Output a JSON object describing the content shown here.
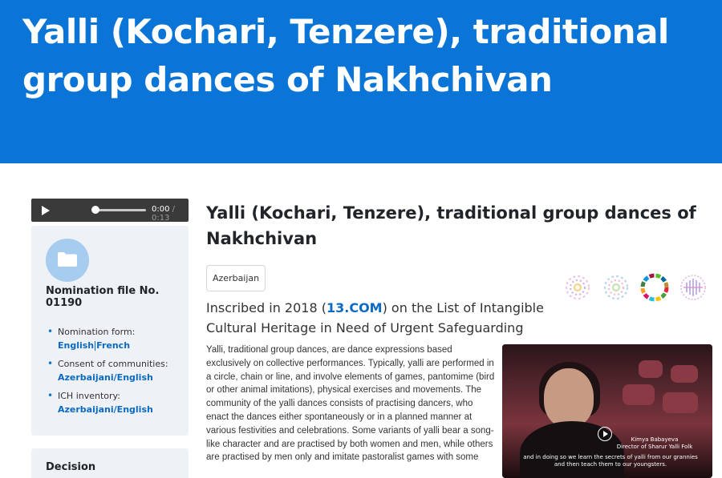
{
  "banner": {
    "title": "Yalli (Kochari, Tenzere), traditional group dances of Nakhchivan"
  },
  "player": {
    "current_time": "0:00",
    "duration": "/ 0:13",
    "progress": 0
  },
  "sidebar": {
    "nomination_title": "Nomination file No. 01190",
    "nomination_form_label": "Nomination form:",
    "nomination_form_links": [
      "English",
      "French"
    ],
    "consent_label": "Consent of communities:",
    "consent_link": "Azerbaijani/English",
    "inventory_label": "ICH inventory:",
    "inventory_link": "Azerbaijani/English",
    "decision_title": "Decision"
  },
  "main": {
    "title": "Yalli (Kochari, Tenzere), traditional group dances of Nakhchivan",
    "country": "Azerbaijan",
    "inscribed_prefix": "Inscribed in 2018 (",
    "inscribed_link": "13.COM",
    "inscribed_suffix": ") on the List of Intangible Cultural Heritage in Need of Urgent Safeguarding",
    "description": "Yalli, traditional group dances, are dance expressions based exclusively on collective performances. Typically, yalli are performed in a circle, chain or line, and involve elements of games, pantomime (bird or other animal imitations), physical exercises and movements. The community of the yalli dances consists of practising dancers, who enact the dances either spontaneously or in a planned manner at various festivities and celebrations. Some variants of yalli bear a song-like character and are practised by both women and men, while others are practised by men only and imitate pastoralist games with some"
  },
  "video": {
    "speaker_name": "Kimya Babayeva",
    "speaker_role": "Director of Sharur Yalli Folk",
    "subtitle": "and in doing so we learn the secrets of yalli from our grannies and then teach them to our youngsters."
  },
  "colors": {
    "banner": "#0a75d6",
    "link": "#0a6ac4",
    "card": "#eef1f5"
  },
  "icons": [
    "play-icon",
    "volume-icon",
    "folder-icon",
    "sdg-icon"
  ]
}
